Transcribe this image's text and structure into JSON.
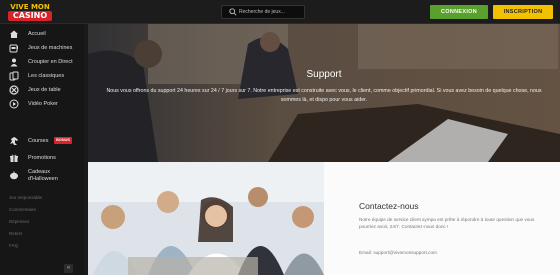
{
  "header": {
    "logo_top": "VIVE MON",
    "logo_bottom": "CASINO",
    "search_placeholder": "Recherche de jeux...",
    "login_label": "CONNEXION",
    "signup_label": "INSCRIPTION"
  },
  "sidebar": {
    "items": [
      {
        "label": "Accueil",
        "icon": "home-icon"
      },
      {
        "label": "Jeux de machines",
        "icon": "slot-machine-icon"
      },
      {
        "label": "Croupier en Direct",
        "icon": "live-dealer-icon"
      },
      {
        "label": "Les classiques",
        "icon": "cards-icon"
      },
      {
        "label": "Jeux de table",
        "icon": "chip-icon"
      },
      {
        "label": "Vidéo Poker",
        "icon": "video-poker-icon"
      },
      {
        "label": "Courses",
        "icon": "horse-icon",
        "badge": "BONUS"
      },
      {
        "label": "Promotions",
        "icon": "gift-icon"
      },
      {
        "label": "Cadeaux d'Halloween",
        "icon": "pumpkin-icon"
      }
    ],
    "footer_links": [
      "Jeu responsable",
      "Commentaire",
      "Dépenses",
      "Retirer",
      "FAQ"
    ],
    "collapse_glyph": "«"
  },
  "hero": {
    "title": "Support",
    "text": "Nous vous offrons du support 24 heures sur 24 / 7 jours sur 7. Notre entreprise est construite avec vous, le client, comme objectif primordial. Si vous avez besoin de quelque chose, nous sommes là, et dispo pour vous aider."
  },
  "contact": {
    "title": "Contactez-nous",
    "text": "Notre équipe de service client sympa est prête à répondre à toute question que vous pourriez avoir, 24/7. Contactez-nous donc !",
    "email": "Email: support@vivemonsupport.com"
  },
  "colors": {
    "accent_yellow": "#f2c200",
    "login_green": "#5aa02c",
    "badge_red": "#d8232a"
  }
}
